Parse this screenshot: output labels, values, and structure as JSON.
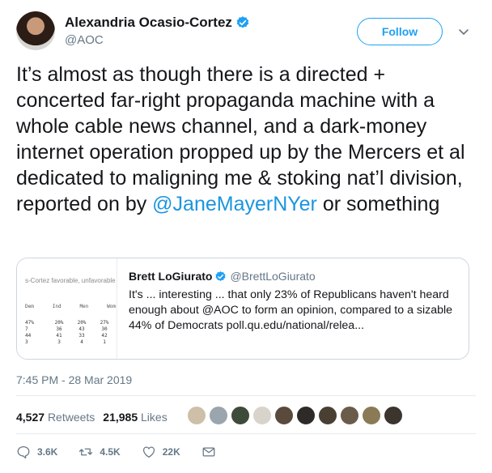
{
  "header": {
    "display_name": "Alexandria Ocasio-Cortez",
    "handle": "@AOC",
    "follow_label": "Follow"
  },
  "tweet": {
    "text_before": "It’s almost as though there is a directed + concerted far-right propaganda machine with a whole cable news channel, and a dark-money internet operation propped up by the Mercers et al dedicated to maligning me & stoking nat’l division, reported on by ",
    "mention": "@JaneMayerNYer",
    "text_after": " or something"
  },
  "quote": {
    "name": "Brett LoGiurato",
    "handle": "@BrettLoGiurato",
    "text": "It's ... interesting ... that only 23% of Republicans haven't heard enough about @AOC to form an opinion, compared to a sizable 44% of Democrats poll.qu.edu/national/relea...",
    "image": {
      "title": "s-Cortez favorable, unfavorable",
      "columns": [
        "Dem",
        "Ind",
        "Men",
        "Wom"
      ],
      "rows": [
        [
          "47%",
          "20%",
          "20%",
          "27%"
        ],
        [
          "7",
          "36",
          "43",
          "30"
        ],
        [
          "44",
          "41",
          "33",
          "42"
        ],
        [
          "3",
          "3",
          "4",
          "1"
        ]
      ]
    }
  },
  "timestamp": "7:45 PM - 28 Mar 2019",
  "stats": {
    "retweets_count": "4,527",
    "retweets_label": "Retweets",
    "likes_count": "21,985",
    "likes_label": "Likes"
  },
  "likers": [
    "#cdbfa8",
    "#9aa5ad",
    "#3e4a3a",
    "#d8d4cc",
    "#5a4a3c",
    "#2e2a28",
    "#4a3f33",
    "#6b5b4b",
    "#8a7a55",
    "#3b352e"
  ],
  "actions": {
    "replies": "3.6K",
    "retweets": "4.5K",
    "likes": "22K"
  },
  "colors": {
    "accent": "#1da1f2",
    "link": "#1b95e0",
    "muted": "#657786",
    "border": "#e6ecf0"
  }
}
